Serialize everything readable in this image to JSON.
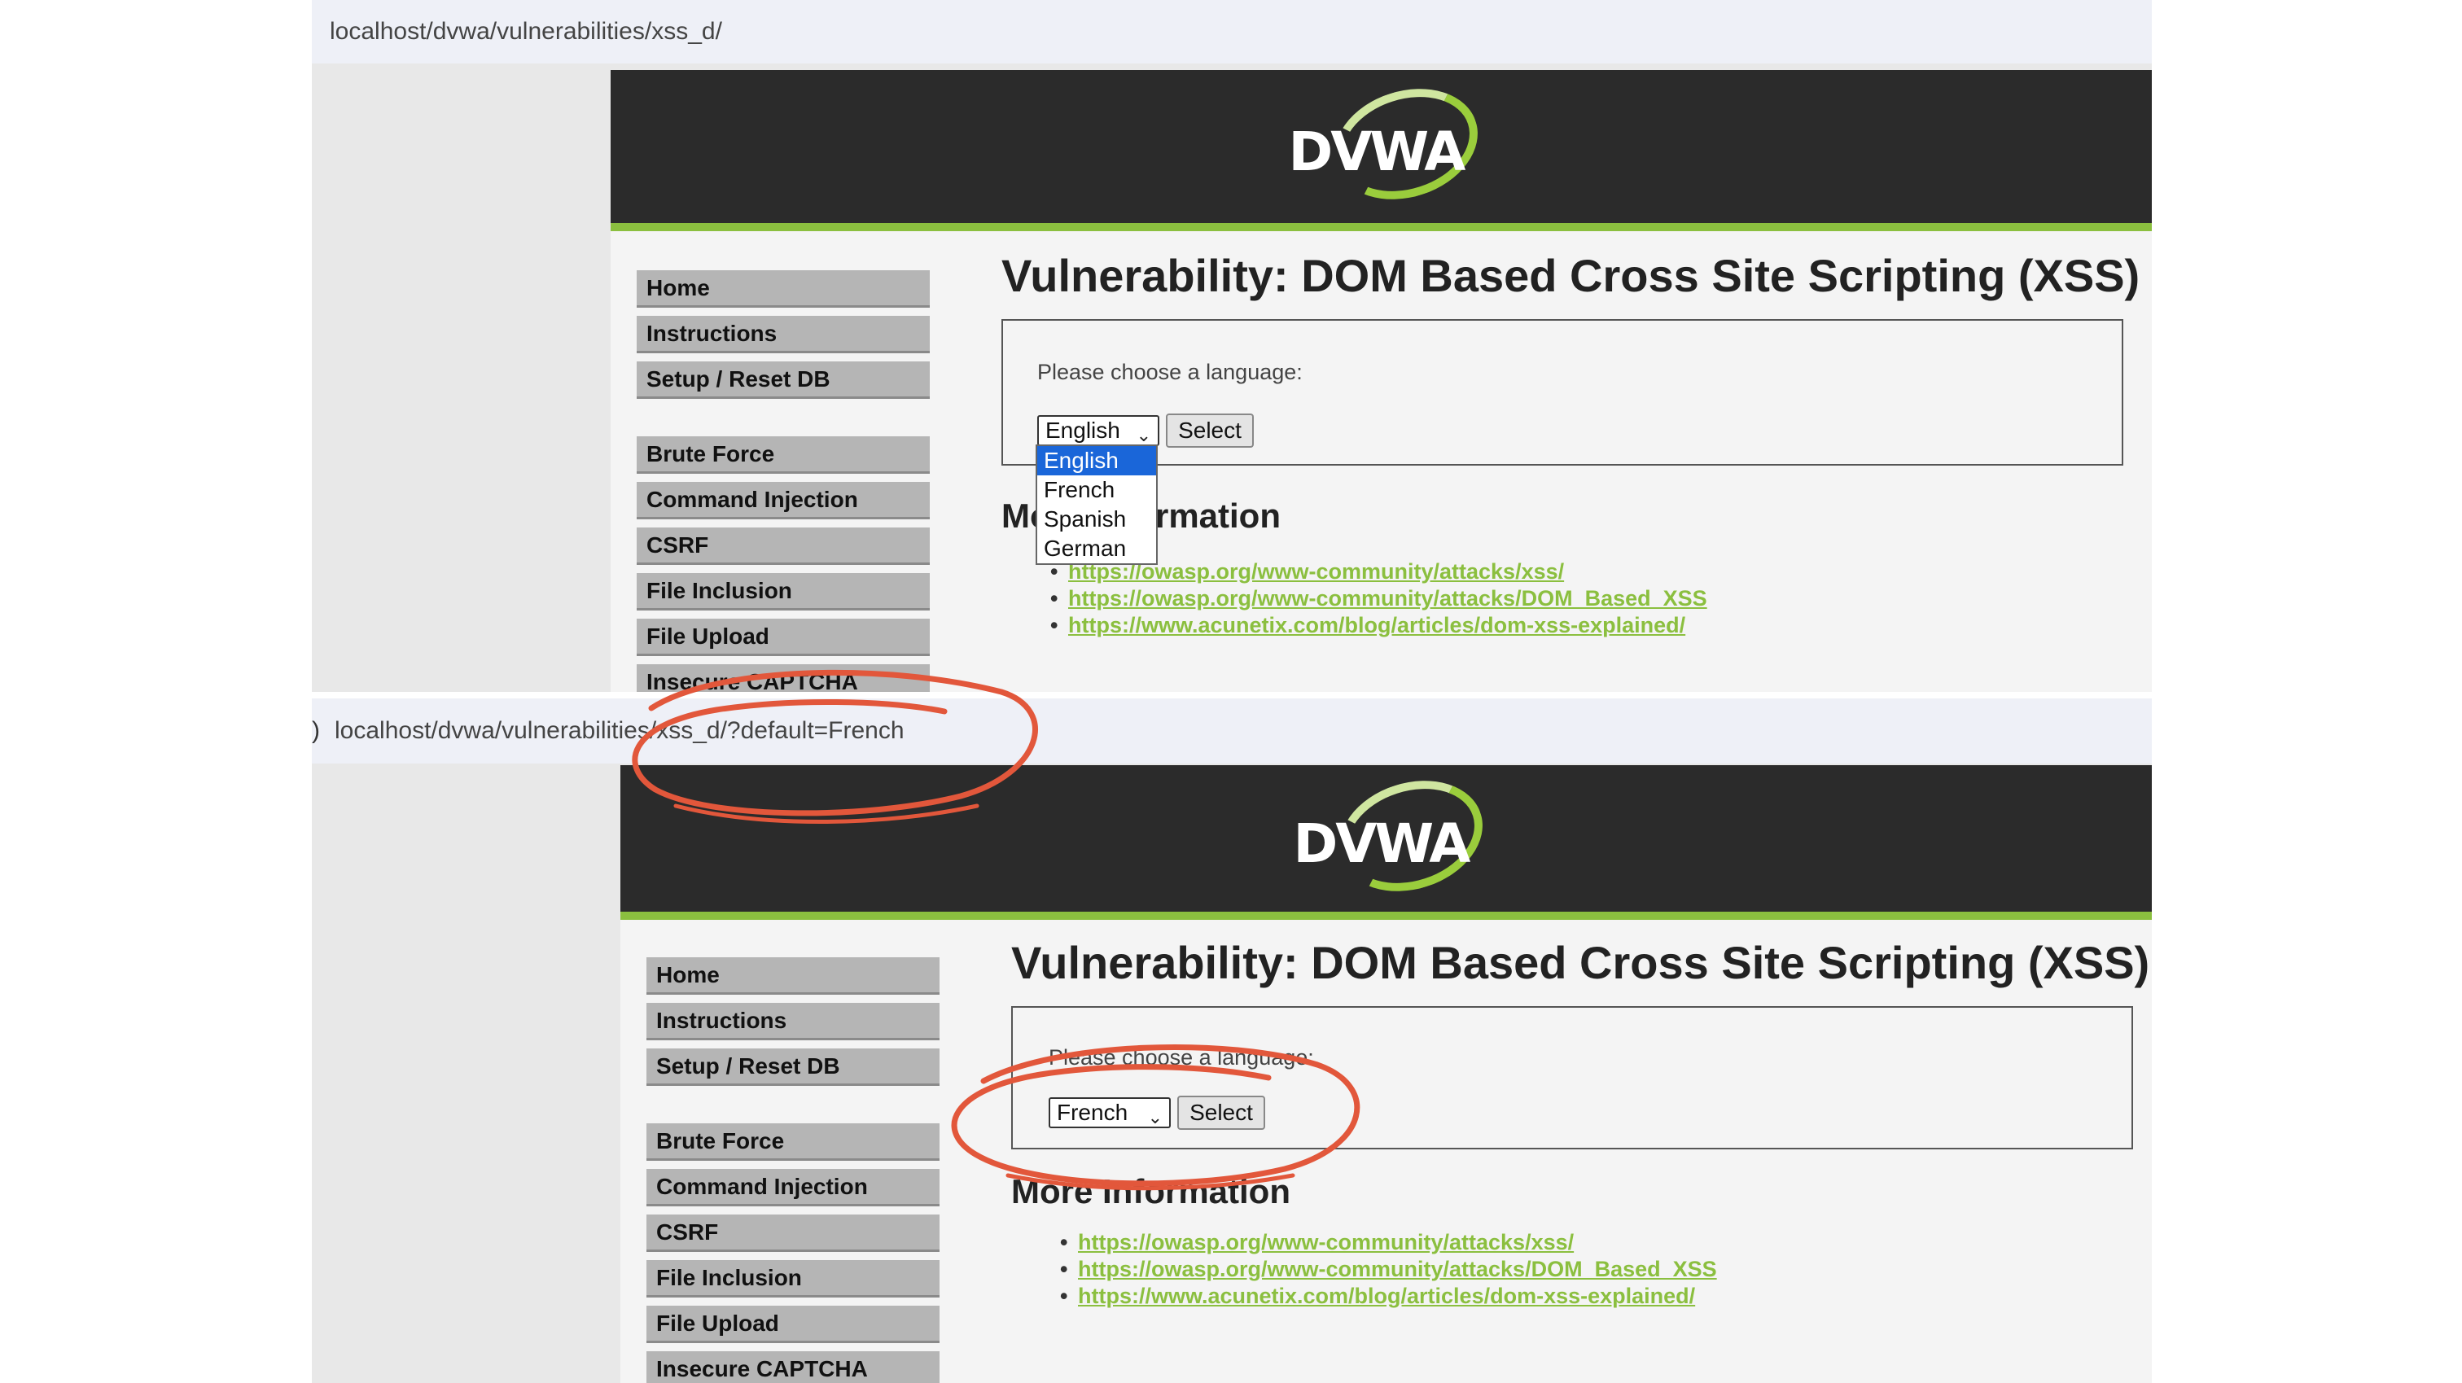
{
  "shot1": {
    "url": "localhost/dvwa/vulnerabilities/xss_d/",
    "logo_text": "DVWA",
    "menu_group1": [
      "Home",
      "Instructions",
      "Setup / Reset DB"
    ],
    "menu_group2": [
      "Brute Force",
      "Command Injection",
      "CSRF",
      "File Inclusion",
      "File Upload",
      "Insecure CAPTCHA"
    ],
    "title": "Vulnerability: DOM Based Cross Site Scripting (XSS)",
    "prompt": "Please choose a language:",
    "select_value": "English",
    "button": "Select",
    "dropdown_options": [
      "English",
      "French",
      "Spanish",
      "German"
    ],
    "more_info": "More Information",
    "links": [
      "https://owasp.org/www-community/attacks/xss/",
      "https://owasp.org/www-community/attacks/DOM_Based_XSS",
      "https://www.acunetix.com/blog/articles/dom-xss-explained/"
    ]
  },
  "shot2": {
    "url": "localhost/dvwa/vulnerabilities/xss_d/?default=French",
    "url_lead": ")",
    "logo_text": "DVWA",
    "menu_group1": [
      "Home",
      "Instructions",
      "Setup / Reset DB"
    ],
    "menu_group2": [
      "Brute Force",
      "Command Injection",
      "CSRF",
      "File Inclusion",
      "File Upload",
      "Insecure CAPTCHA"
    ],
    "title": "Vulnerability: DOM Based Cross Site Scripting (XSS)",
    "prompt": "Please choose a language:",
    "select_value": "French",
    "button": "Select",
    "more_info": "More Information",
    "links": [
      "https://owasp.org/www-community/attacks/xss/",
      "https://owasp.org/www-community/attacks/DOM_Based_XSS",
      "https://www.acunetix.com/blog/articles/dom-xss-explained/"
    ]
  },
  "colors": {
    "header": "#2b2b2b",
    "accent_green": "#8bbf3f",
    "annotation_red": "#e2573b",
    "menu_gray": "#b5b5b5"
  }
}
